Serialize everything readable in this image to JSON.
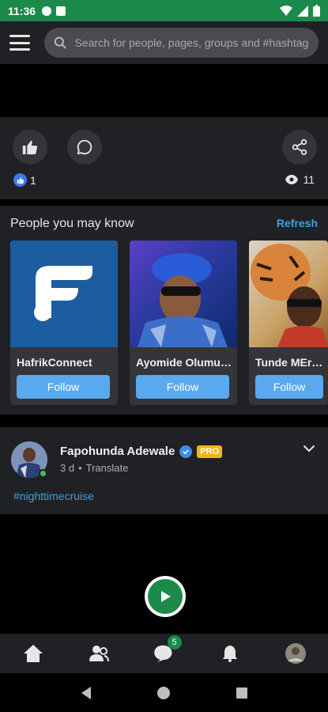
{
  "status_bar": {
    "time": "11:36"
  },
  "header": {
    "search_placeholder": "Search for people, pages, groups and #hashtags"
  },
  "actions": {
    "like_count": "1",
    "view_count": "11"
  },
  "people_you_may_know": {
    "title": "People you may know",
    "refresh_label": "Refresh",
    "cards": [
      {
        "name": "HafrikConnect",
        "follow_label": "Follow"
      },
      {
        "name": "Ayomide Olumuyiwa",
        "follow_label": "Follow"
      },
      {
        "name": "Tunde MErcy",
        "follow_label": "Follow"
      }
    ]
  },
  "post": {
    "author": "Fapohunda Adewale",
    "badge": "PRO",
    "time": "3 d",
    "separator": "•",
    "translate_label": "Translate",
    "hashtag": "#nighttimecruise"
  },
  "bottom_nav": {
    "messages_badge": "5"
  },
  "colors": {
    "accent": "#1b8a4a",
    "link": "#3ea0e8",
    "follow": "#5aa9ee",
    "pro": "#f2b515"
  }
}
